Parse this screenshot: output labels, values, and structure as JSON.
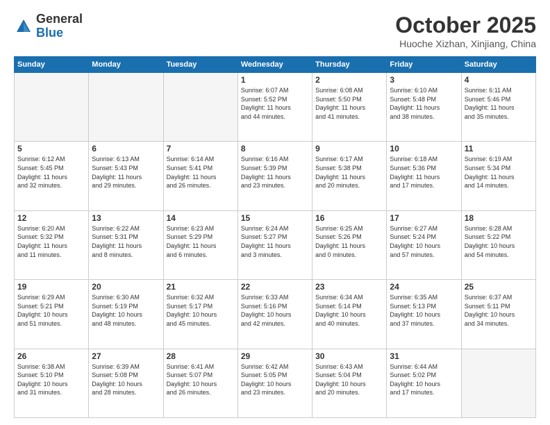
{
  "header": {
    "logo_general": "General",
    "logo_blue": "Blue",
    "month": "October 2025",
    "location": "Huoche Xizhan, Xinjiang, China"
  },
  "weekdays": [
    "Sunday",
    "Monday",
    "Tuesday",
    "Wednesday",
    "Thursday",
    "Friday",
    "Saturday"
  ],
  "weeks": [
    [
      {
        "day": "",
        "info": ""
      },
      {
        "day": "",
        "info": ""
      },
      {
        "day": "",
        "info": ""
      },
      {
        "day": "1",
        "info": "Sunrise: 6:07 AM\nSunset: 5:52 PM\nDaylight: 11 hours\nand 44 minutes."
      },
      {
        "day": "2",
        "info": "Sunrise: 6:08 AM\nSunset: 5:50 PM\nDaylight: 11 hours\nand 41 minutes."
      },
      {
        "day": "3",
        "info": "Sunrise: 6:10 AM\nSunset: 5:48 PM\nDaylight: 11 hours\nand 38 minutes."
      },
      {
        "day": "4",
        "info": "Sunrise: 6:11 AM\nSunset: 5:46 PM\nDaylight: 11 hours\nand 35 minutes."
      }
    ],
    [
      {
        "day": "5",
        "info": "Sunrise: 6:12 AM\nSunset: 5:45 PM\nDaylight: 11 hours\nand 32 minutes."
      },
      {
        "day": "6",
        "info": "Sunrise: 6:13 AM\nSunset: 5:43 PM\nDaylight: 11 hours\nand 29 minutes."
      },
      {
        "day": "7",
        "info": "Sunrise: 6:14 AM\nSunset: 5:41 PM\nDaylight: 11 hours\nand 26 minutes."
      },
      {
        "day": "8",
        "info": "Sunrise: 6:16 AM\nSunset: 5:39 PM\nDaylight: 11 hours\nand 23 minutes."
      },
      {
        "day": "9",
        "info": "Sunrise: 6:17 AM\nSunset: 5:38 PM\nDaylight: 11 hours\nand 20 minutes."
      },
      {
        "day": "10",
        "info": "Sunrise: 6:18 AM\nSunset: 5:36 PM\nDaylight: 11 hours\nand 17 minutes."
      },
      {
        "day": "11",
        "info": "Sunrise: 6:19 AM\nSunset: 5:34 PM\nDaylight: 11 hours\nand 14 minutes."
      }
    ],
    [
      {
        "day": "12",
        "info": "Sunrise: 6:20 AM\nSunset: 5:32 PM\nDaylight: 11 hours\nand 11 minutes."
      },
      {
        "day": "13",
        "info": "Sunrise: 6:22 AM\nSunset: 5:31 PM\nDaylight: 11 hours\nand 8 minutes."
      },
      {
        "day": "14",
        "info": "Sunrise: 6:23 AM\nSunset: 5:29 PM\nDaylight: 11 hours\nand 6 minutes."
      },
      {
        "day": "15",
        "info": "Sunrise: 6:24 AM\nSunset: 5:27 PM\nDaylight: 11 hours\nand 3 minutes."
      },
      {
        "day": "16",
        "info": "Sunrise: 6:25 AM\nSunset: 5:26 PM\nDaylight: 11 hours\nand 0 minutes."
      },
      {
        "day": "17",
        "info": "Sunrise: 6:27 AM\nSunset: 5:24 PM\nDaylight: 10 hours\nand 57 minutes."
      },
      {
        "day": "18",
        "info": "Sunrise: 6:28 AM\nSunset: 5:22 PM\nDaylight: 10 hours\nand 54 minutes."
      }
    ],
    [
      {
        "day": "19",
        "info": "Sunrise: 6:29 AM\nSunset: 5:21 PM\nDaylight: 10 hours\nand 51 minutes."
      },
      {
        "day": "20",
        "info": "Sunrise: 6:30 AM\nSunset: 5:19 PM\nDaylight: 10 hours\nand 48 minutes."
      },
      {
        "day": "21",
        "info": "Sunrise: 6:32 AM\nSunset: 5:17 PM\nDaylight: 10 hours\nand 45 minutes."
      },
      {
        "day": "22",
        "info": "Sunrise: 6:33 AM\nSunset: 5:16 PM\nDaylight: 10 hours\nand 42 minutes."
      },
      {
        "day": "23",
        "info": "Sunrise: 6:34 AM\nSunset: 5:14 PM\nDaylight: 10 hours\nand 40 minutes."
      },
      {
        "day": "24",
        "info": "Sunrise: 6:35 AM\nSunset: 5:13 PM\nDaylight: 10 hours\nand 37 minutes."
      },
      {
        "day": "25",
        "info": "Sunrise: 6:37 AM\nSunset: 5:11 PM\nDaylight: 10 hours\nand 34 minutes."
      }
    ],
    [
      {
        "day": "26",
        "info": "Sunrise: 6:38 AM\nSunset: 5:10 PM\nDaylight: 10 hours\nand 31 minutes."
      },
      {
        "day": "27",
        "info": "Sunrise: 6:39 AM\nSunset: 5:08 PM\nDaylight: 10 hours\nand 28 minutes."
      },
      {
        "day": "28",
        "info": "Sunrise: 6:41 AM\nSunset: 5:07 PM\nDaylight: 10 hours\nand 26 minutes."
      },
      {
        "day": "29",
        "info": "Sunrise: 6:42 AM\nSunset: 5:05 PM\nDaylight: 10 hours\nand 23 minutes."
      },
      {
        "day": "30",
        "info": "Sunrise: 6:43 AM\nSunset: 5:04 PM\nDaylight: 10 hours\nand 20 minutes."
      },
      {
        "day": "31",
        "info": "Sunrise: 6:44 AM\nSunset: 5:02 PM\nDaylight: 10 hours\nand 17 minutes."
      },
      {
        "day": "",
        "info": ""
      }
    ]
  ]
}
